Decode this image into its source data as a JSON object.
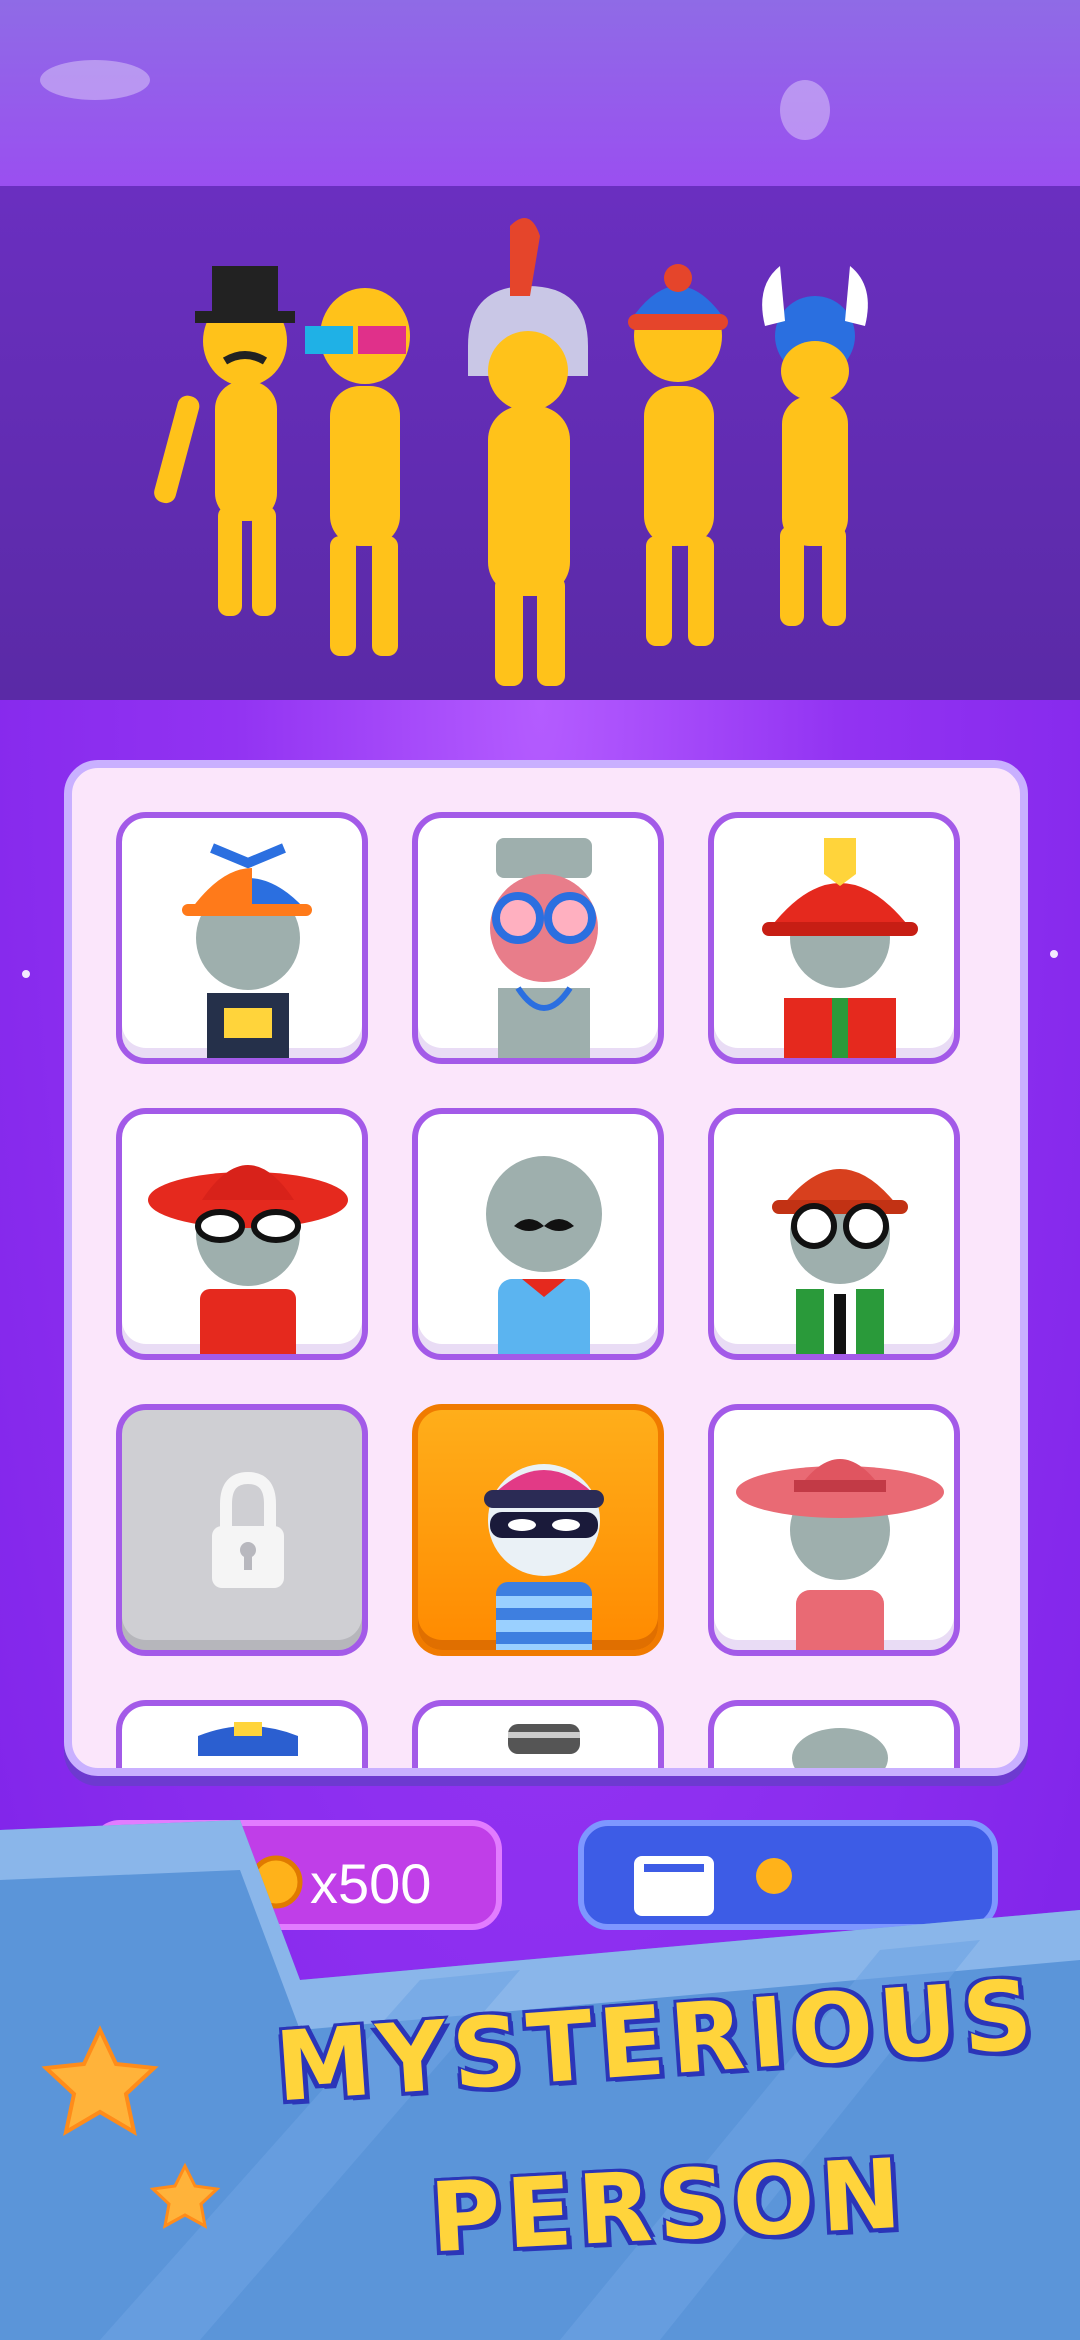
{
  "banner": {
    "title_line_1": "MYSTERIOUS",
    "title_line_2": "PERSON"
  },
  "shop": {
    "coin_button_label": "x500",
    "items": [
      {
        "name": "propeller-cap",
        "state": "unlocked"
      },
      {
        "name": "doctor-glasses",
        "state": "unlocked"
      },
      {
        "name": "firefighter-helmet",
        "state": "unlocked"
      },
      {
        "name": "red-hat-glasses",
        "state": "unlocked"
      },
      {
        "name": "mustache",
        "state": "unlocked"
      },
      {
        "name": "hardhat-glasses",
        "state": "unlocked"
      },
      {
        "name": "locked",
        "state": "locked"
      },
      {
        "name": "burglar-mask",
        "state": "selected"
      },
      {
        "name": "cowboy-hat",
        "state": "unlocked"
      }
    ]
  },
  "colors": {
    "accent": "#ff8a00",
    "title": "#ffd43b",
    "panel": "#fbe6fb"
  }
}
